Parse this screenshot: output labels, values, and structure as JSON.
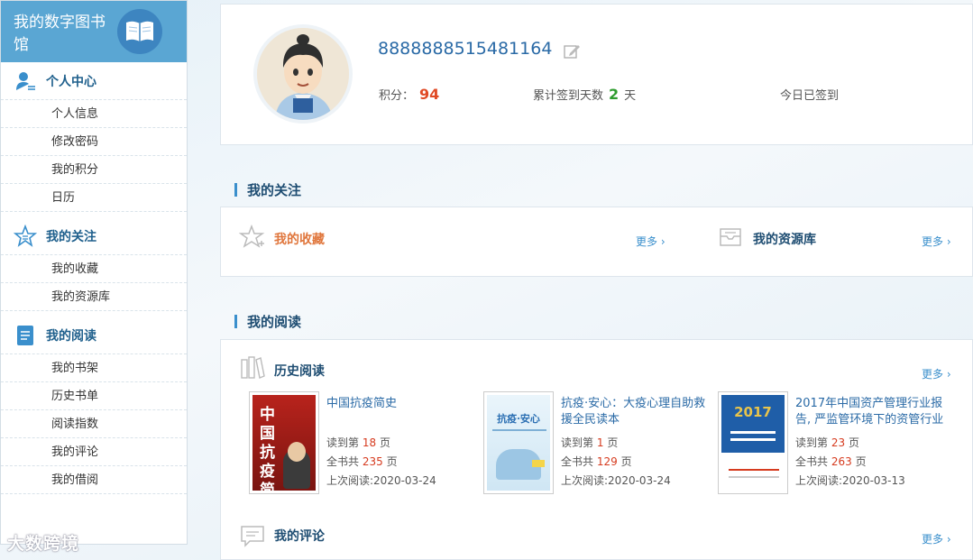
{
  "sidebar": {
    "title": "我的数字图书馆",
    "sections": [
      {
        "label": "个人中心",
        "items": [
          "个人信息",
          "修改密码",
          "我的积分",
          "日历"
        ]
      },
      {
        "label": "我的关注",
        "items": [
          "我的收藏",
          "我的资源库"
        ]
      },
      {
        "label": "我的阅读",
        "items": [
          "我的书架",
          "历史书单",
          "阅读指数",
          "我的评论",
          "我的借阅"
        ]
      }
    ]
  },
  "profile": {
    "username": "8888888515481164",
    "points_label": "积分：",
    "points": "94",
    "days_label": "累计签到天数",
    "days": "2",
    "days_unit": "天",
    "checkin_status": "今日已签到"
  },
  "follow": {
    "title": "我的关注",
    "favorites_label": "我的收藏",
    "resources_label": "我的资源库",
    "more": "更多 ›"
  },
  "reading": {
    "title": "我的阅读",
    "history_label": "历史阅读",
    "comments_label": "我的评论",
    "more": "更多 ›",
    "books": [
      {
        "title": "中国抗疫简史",
        "read_prefix": "读到第",
        "read_page": "18",
        "read_suffix": "页",
        "total_prefix": "全书共",
        "total_pages": "235",
        "total_suffix": "页",
        "last_read": "上次阅读:2020-03-24",
        "cover_text": "中国抗疫简史"
      },
      {
        "title": "抗疫·安心：大疫心理自助救援全民读本",
        "read_prefix": "读到第",
        "read_page": "1",
        "read_suffix": "页",
        "total_prefix": "全书共",
        "total_pages": "129",
        "total_suffix": "页",
        "last_read": "上次阅读:2020-03-24",
        "cover_text": "抗疫·安心"
      },
      {
        "title": "2017年中国资产管理行业报告, 严监管环境下的资管行业",
        "read_prefix": "读到第",
        "read_page": "23",
        "read_suffix": "页",
        "total_prefix": "全书共",
        "total_pages": "263",
        "total_suffix": "页",
        "last_read": "上次阅读:2020-03-13",
        "cover_text": "2017"
      }
    ]
  },
  "watermark": "大数跨境",
  "colors": {
    "accent": "#5aa6d3",
    "link": "#2a6aa6",
    "red": "#e04a25",
    "green": "#2e9c2e"
  }
}
